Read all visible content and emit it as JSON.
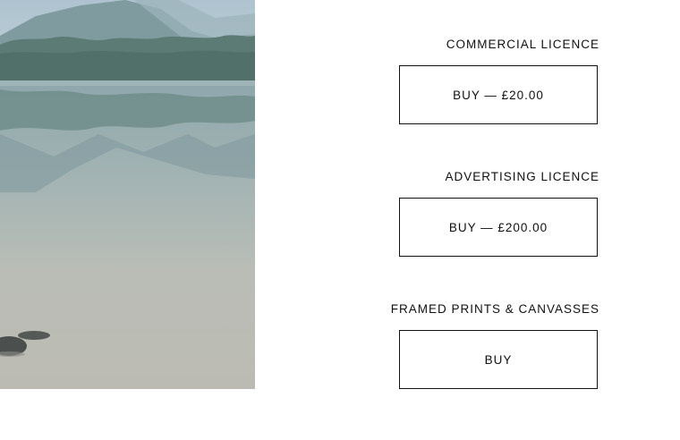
{
  "colors": {
    "text": "#111111",
    "border": "#111111",
    "background": "#ffffff"
  },
  "licences": [
    {
      "title": "COMMERCIAL LICENCE",
      "button_label": "BUY — £20.00"
    },
    {
      "title": "ADVERTISING LICENCE",
      "button_label": "BUY — £200.00"
    },
    {
      "title": "FRAMED PRINTS & CANVASSES",
      "button_label": "BUY"
    }
  ]
}
